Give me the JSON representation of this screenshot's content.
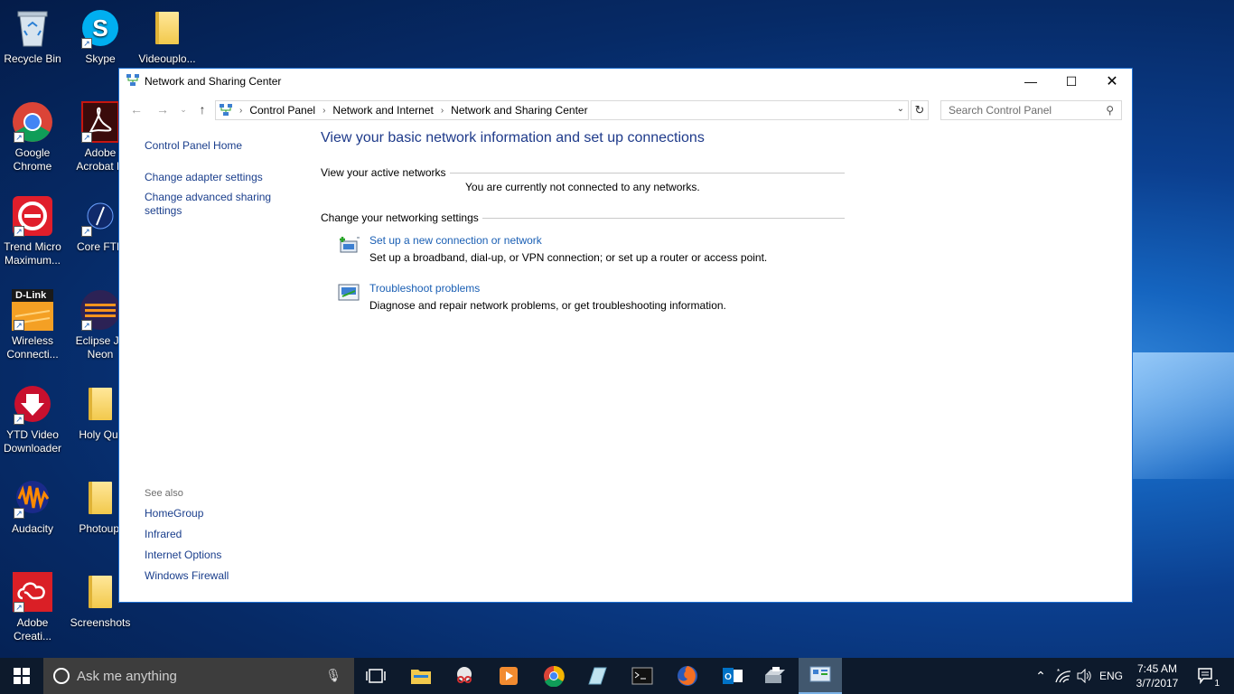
{
  "desktop": {
    "icons": [
      {
        "label": "Recycle Bin"
      },
      {
        "label": "Skype"
      },
      {
        "label": "Videouplo..."
      },
      {
        "label": "Google\nChrome"
      },
      {
        "label": "Adobe\nAcrobat D"
      },
      {
        "label": "Trend Micro\nMaximum..."
      },
      {
        "label": "Core FTP"
      },
      {
        "label": "Wireless\nConnecti..."
      },
      {
        "label": "Eclipse Ja\nNeon"
      },
      {
        "label": "YTD Video\nDownloader"
      },
      {
        "label": "Holy Qur"
      },
      {
        "label": "Audacity"
      },
      {
        "label": "Photoupl"
      },
      {
        "label": "Adobe\nCreati..."
      },
      {
        "label": "Screenshots"
      }
    ],
    "dlink_text": "D-Link"
  },
  "window": {
    "title": "Network and Sharing Center",
    "breadcrumbs": [
      "Control Panel",
      "Network and Internet",
      "Network and Sharing Center"
    ],
    "search_placeholder": "Search Control Panel",
    "left_links": [
      "Control Panel Home",
      "Change adapter settings",
      "Change advanced sharing\nsettings"
    ],
    "see_also": {
      "header": "See also",
      "links": [
        "HomeGroup",
        "Infrared",
        "Internet Options",
        "Windows Firewall"
      ]
    },
    "heading": "View your basic network information and set up connections",
    "active_networks": {
      "header": "View your active networks",
      "message": "You are currently not connected to any networks."
    },
    "networking_settings": {
      "header": "Change your networking settings",
      "tasks": [
        {
          "link": "Set up a new connection or network",
          "desc": "Set up a broadband, dial-up, or VPN connection; or set up a router or access point."
        },
        {
          "link": "Troubleshoot problems",
          "desc": "Diagnose and repair network problems, or get troubleshooting information."
        }
      ]
    }
  },
  "taskbar": {
    "search_placeholder": "Ask me anything",
    "language": "ENG",
    "time": "7:45 AM",
    "date": "3/7/2017",
    "notification_count": "1"
  },
  "colors": {
    "link": "#1a5fb4",
    "heading": "#1e3a8a",
    "taskbar": "#0d1a2c",
    "window_border": "#1e6fd0"
  }
}
